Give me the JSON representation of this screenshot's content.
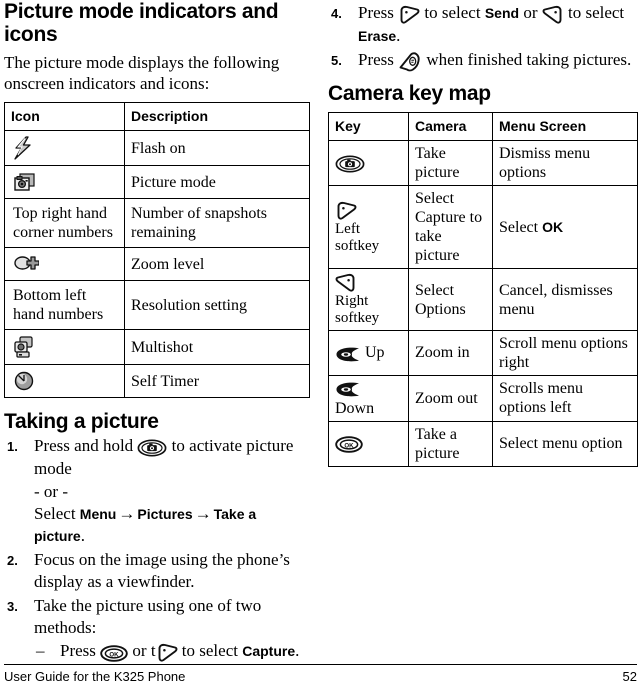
{
  "left_column": {
    "heading": "Picture mode indicators and icons",
    "intro": "The picture mode displays the following onscreen indicators and icons:",
    "icon_table": {
      "headers": [
        "Icon",
        "Description"
      ],
      "rows": [
        {
          "icon": "flash-on-icon",
          "icon_text": "",
          "description": "Flash on"
        },
        {
          "icon": "picture-mode-icon",
          "icon_text": "",
          "description": "Picture mode"
        },
        {
          "icon": "",
          "icon_text": "Top right hand corner numbers",
          "description": "Number of snapshots remaining"
        },
        {
          "icon": "zoom-level-icon",
          "icon_text": "",
          "description": "Zoom level"
        },
        {
          "icon": "",
          "icon_text": "Bottom left hand numbers",
          "description": "Resolution setting"
        },
        {
          "icon": "multishot-icon",
          "icon_text": "",
          "description": "Multishot"
        },
        {
          "icon": "self-timer-icon",
          "icon_text": "",
          "description": "Self Timer"
        }
      ]
    },
    "taking_a_picture": {
      "heading": "Taking a picture",
      "steps": [
        {
          "num": "1.",
          "parts": [
            {
              "t": "text",
              "v": "Press and hold "
            },
            {
              "t": "icon",
              "v": "camera-key-icon"
            },
            {
              "t": "text",
              "v": " to activate picture mode"
            }
          ],
          "or_line": "- or -",
          "extra_parts": [
            {
              "t": "text",
              "v": "Select "
            },
            {
              "t": "bold",
              "v": "Menu"
            },
            {
              "t": "arrow",
              "v": "→"
            },
            {
              "t": "bold",
              "v": "Pictures"
            },
            {
              "t": "arrow",
              "v": "→"
            },
            {
              "t": "bold",
              "v": "Take a picture"
            },
            {
              "t": "text",
              "v": "."
            }
          ]
        },
        {
          "num": "2.",
          "parts": [
            {
              "t": "text",
              "v": "Focus on the image using the phone’s display as a viewfinder."
            }
          ]
        },
        {
          "num": "3.",
          "parts": [
            {
              "t": "text",
              "v": "Take the picture using one of two methods:"
            }
          ],
          "substeps": [
            {
              "dash": "–",
              "parts": [
                {
                  "t": "text",
                  "v": "Press "
                },
                {
                  "t": "icon",
                  "v": "ok-key-icon"
                },
                {
                  "t": "text",
                  "v": " or t"
                },
                {
                  "t": "icon",
                  "v": "left-softkey-icon"
                },
                {
                  "t": "text",
                  "v": " to select "
                },
                {
                  "t": "bold",
                  "v": "Capture"
                },
                {
                  "t": "text",
                  "v": "."
                }
              ]
            }
          ]
        }
      ]
    }
  },
  "right_column": {
    "steps": [
      {
        "num": "4.",
        "parts": [
          {
            "t": "text",
            "v": "Press "
          },
          {
            "t": "icon",
            "v": "left-softkey-icon"
          },
          {
            "t": "text",
            "v": " to select "
          },
          {
            "t": "bold",
            "v": "Send"
          },
          {
            "t": "text",
            "v": " or "
          },
          {
            "t": "icon",
            "v": "right-softkey-icon"
          },
          {
            "t": "text",
            "v": " to select "
          },
          {
            "t": "bold",
            "v": "Erase"
          },
          {
            "t": "text",
            "v": "."
          }
        ]
      },
      {
        "num": "5.",
        "parts": [
          {
            "t": "text",
            "v": "Press "
          },
          {
            "t": "icon",
            "v": "end-call-key-icon"
          },
          {
            "t": "text",
            "v": " when finished taking pictures."
          }
        ]
      }
    ],
    "key_map": {
      "heading": "Camera key map",
      "headers": [
        "Key",
        "Camera",
        "Menu Screen"
      ],
      "rows": [
        {
          "key_icon": "camera-key-icon",
          "key_label": "",
          "camera": "Take picture",
          "camera_bold": "",
          "menu_screen": "Dismiss menu options",
          "menu_bold": ""
        },
        {
          "key_icon": "left-softkey-icon",
          "key_label": "Left softkey",
          "camera": "Select Capture to take picture",
          "camera_bold": "",
          "menu_screen": "Select ",
          "menu_bold": "OK"
        },
        {
          "key_icon": "right-softkey-icon",
          "key_label": "Right softkey",
          "camera": "Select Options",
          "camera_bold": "",
          "menu_screen": "Cancel, dismisses menu",
          "menu_bold": ""
        },
        {
          "key_icon": "nav-key-icon",
          "key_label": "Up",
          "camera": "Zoom in",
          "camera_bold": "",
          "menu_screen": "Scroll menu options right",
          "menu_bold": ""
        },
        {
          "key_icon": "nav-key-icon",
          "key_label": "Down",
          "camera": "Zoom out",
          "camera_bold": "",
          "menu_screen": "Scrolls menu options left",
          "menu_bold": ""
        },
        {
          "key_icon": "ok-key-icon",
          "key_label": "",
          "camera": "Take a picture",
          "camera_bold": "",
          "menu_screen": "Select menu option",
          "menu_bold": ""
        }
      ]
    }
  },
  "footer": {
    "left": "User Guide for the K325 Phone",
    "page_number": "52"
  }
}
